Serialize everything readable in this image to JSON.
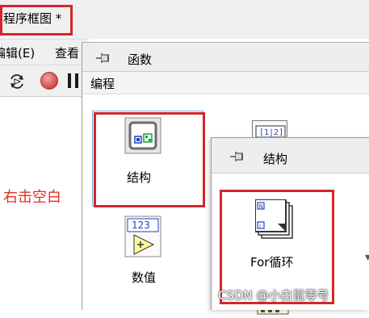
{
  "window": {
    "title": "程序框图 *"
  },
  "menubar": {
    "items": [
      "编辑(E)",
      "查看"
    ]
  },
  "annotation": {
    "text": "右击空白"
  },
  "functions_palette": {
    "title": "函数",
    "category": "编程",
    "items": [
      {
        "label": "结构",
        "icon": "structures-icon"
      },
      {
        "label": "数值",
        "icon": "numeric-icon",
        "icon_text": "123"
      }
    ],
    "extra_icons": [
      "array-icon",
      "cluster-icon"
    ]
  },
  "structures_palette": {
    "title": "结构",
    "items": [
      {
        "label": "For循环",
        "icon": "for-loop-icon"
      }
    ]
  },
  "watermark": "CSDN @小白鼠零号",
  "colors": {
    "highlight": "#d4262d",
    "annotation": "#e0302b",
    "selection": "#7aaee0"
  }
}
